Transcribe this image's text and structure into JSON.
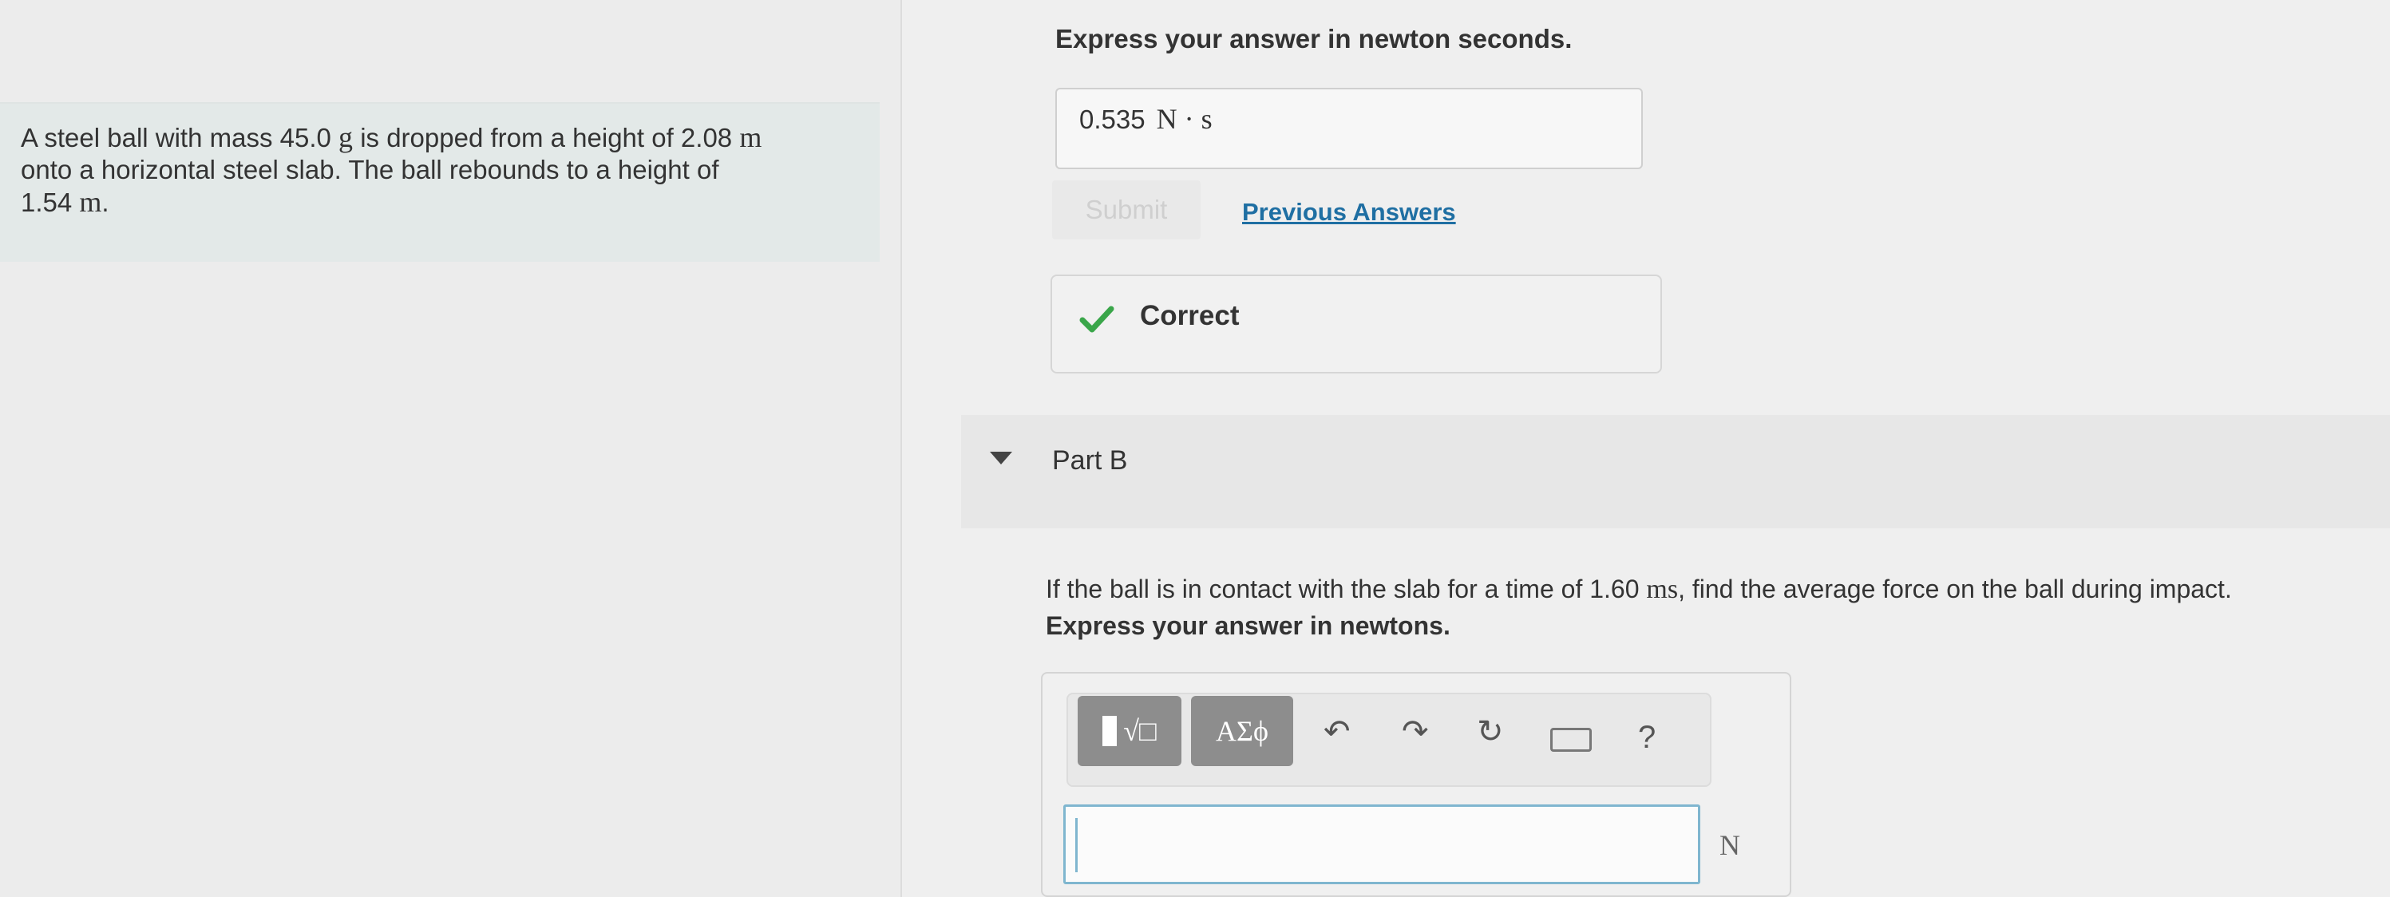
{
  "problem": {
    "line1_a": "A steel ball with mass 45.0 ",
    "line1_b": "g",
    "line1_c": " is dropped from a height of 2.08 ",
    "line1_d": "m",
    "line2": "onto a horizontal steel slab. The ball rebounds to a height of",
    "line3_a": "1.54 ",
    "line3_b": "m",
    "line3_c": "."
  },
  "part_a": {
    "instruction": "Express your answer in newton seconds.",
    "answer_value": "0.535",
    "answer_unit": "N · s",
    "submit_label": "Submit",
    "previous_answers_label": "Previous Answers",
    "feedback": "Correct"
  },
  "part_b": {
    "title": "Part B",
    "question_a": "If the ball is in contact with the slab for a time of 1.60 ",
    "question_b": "ms",
    "question_c": ", find the average force on the ball during impact.",
    "instruction": "Express your answer in newtons.",
    "toolbar": {
      "templates_label": "√□",
      "symbols_label": "ΑΣϕ",
      "help_label": "?"
    },
    "answer_value": "",
    "unit": "N"
  },
  "colors": {
    "problem_bg": "#e3e9e8",
    "link": "#1f6fa3",
    "correct_check": "#3aa64a",
    "input_border": "#7fb6cf"
  },
  "icons": [
    "check-icon",
    "collapse-triangle-icon",
    "undo-icon",
    "redo-icon",
    "reset-icon",
    "keyboard-icon",
    "help-icon"
  ]
}
